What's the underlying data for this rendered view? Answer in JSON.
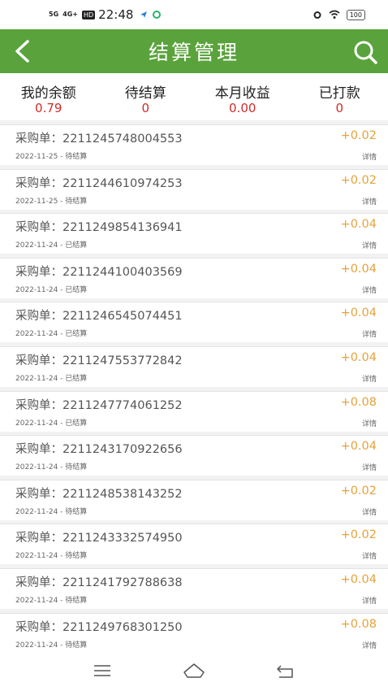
{
  "status_bar": {
    "signal1": "5G",
    "signal2": "4G+",
    "hd": "HD",
    "time": "22:48",
    "battery": "100"
  },
  "header": {
    "title": "结算管理"
  },
  "summary": [
    {
      "label": "我的余额",
      "value": "0.79"
    },
    {
      "label": "待结算",
      "value": "0"
    },
    {
      "label": "本月收益",
      "value": "0.00"
    },
    {
      "label": "已打款",
      "value": "0"
    }
  ],
  "orders": [
    {
      "label": "采购单：",
      "number": "2211245748004553",
      "meta": "2022-11-25 - 待结算",
      "amount": "+0.02",
      "detail": "详情"
    },
    {
      "label": "采购单：",
      "number": "2211244610974253",
      "meta": "2022-11-25 - 待结算",
      "amount": "+0.02",
      "detail": "详情"
    },
    {
      "label": "采购单：",
      "number": "2211249854136941",
      "meta": "2022-11-24 - 已结算",
      "amount": "+0.04",
      "detail": "详情"
    },
    {
      "label": "采购单：",
      "number": "2211244100403569",
      "meta": "2022-11-24 - 已结算",
      "amount": "+0.04",
      "detail": "详情"
    },
    {
      "label": "采购单：",
      "number": "2211246545074451",
      "meta": "2022-11-24 - 已结算",
      "amount": "+0.04",
      "detail": "详情"
    },
    {
      "label": "采购单：",
      "number": "2211247553772842",
      "meta": "2022-11-24 - 已结算",
      "amount": "+0.04",
      "detail": "详情"
    },
    {
      "label": "采购单：",
      "number": "2211247774061252",
      "meta": "2022-11-24 - 已结算",
      "amount": "+0.08",
      "detail": "详情"
    },
    {
      "label": "采购单：",
      "number": "2211243170922656",
      "meta": "2022-11-24 - 待结算",
      "amount": "+0.04",
      "detail": "详情"
    },
    {
      "label": "采购单：",
      "number": "2211248538143252",
      "meta": "2022-11-24 - 待结算",
      "amount": "+0.02",
      "detail": "详情"
    },
    {
      "label": "采购单：",
      "number": "2211243332574950",
      "meta": "2022-11-24 - 待结算",
      "amount": "+0.02",
      "detail": "详情"
    },
    {
      "label": "采购单：",
      "number": "2211241792788638",
      "meta": "2022-11-24 - 待结算",
      "amount": "+0.04",
      "detail": "详情"
    },
    {
      "label": "采购单：",
      "number": "2211249768301250",
      "meta": "2022-11-24 - 待结算",
      "amount": "+0.08",
      "detail": "详情"
    }
  ],
  "icons": {
    "back": "chevron-left-icon",
    "search": "search-icon",
    "nav_menu": "menu-icon",
    "nav_home": "home-icon",
    "nav_back": "back-icon"
  },
  "colors": {
    "header_green": "#5aa33c",
    "value_red": "#d32b2b",
    "amount_orange": "#e6a23c"
  }
}
